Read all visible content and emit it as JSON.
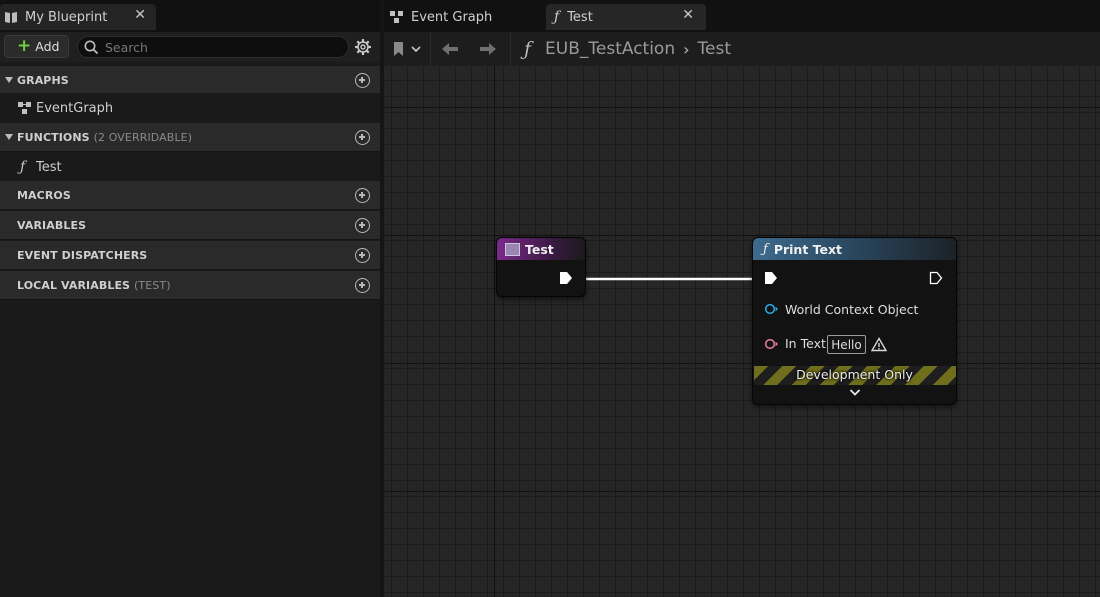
{
  "left_panel": {
    "tab_title": "My Blueprint",
    "add_label": "Add",
    "search_placeholder": "Search",
    "sections": {
      "graphs": "GRAPHS",
      "functions": "FUNCTIONS",
      "functions_sub": "(2 OVERRIDABLE)",
      "macros": "MACROS",
      "variables": "VARIABLES",
      "dispatchers": "EVENT DISPATCHERS",
      "local_variables": "LOCAL VARIABLES",
      "local_variables_sub": "(TEST)"
    },
    "items": {
      "event_graph": "EventGraph",
      "test_function": "Test"
    }
  },
  "graph_tabs": {
    "event_graph": "Event Graph",
    "test": "Test"
  },
  "breadcrumb": {
    "blueprint": "EUB_TestAction",
    "function": "Test"
  },
  "nodes": {
    "entry": {
      "title": "Test",
      "header_color": "#7a2a8a"
    },
    "print_text": {
      "title": "Print Text",
      "header_color": "#3d6b8e",
      "world_context_label": "World Context Object",
      "in_text_label": "In Text",
      "in_text_value": "Hello",
      "dev_only_label": "Development Only"
    }
  },
  "colors": {
    "add_icon": "#6ccf41",
    "object_pin": "#2aa3e0",
    "text_pin": "#e07a9a",
    "exec_pin": "#ffffff"
  }
}
